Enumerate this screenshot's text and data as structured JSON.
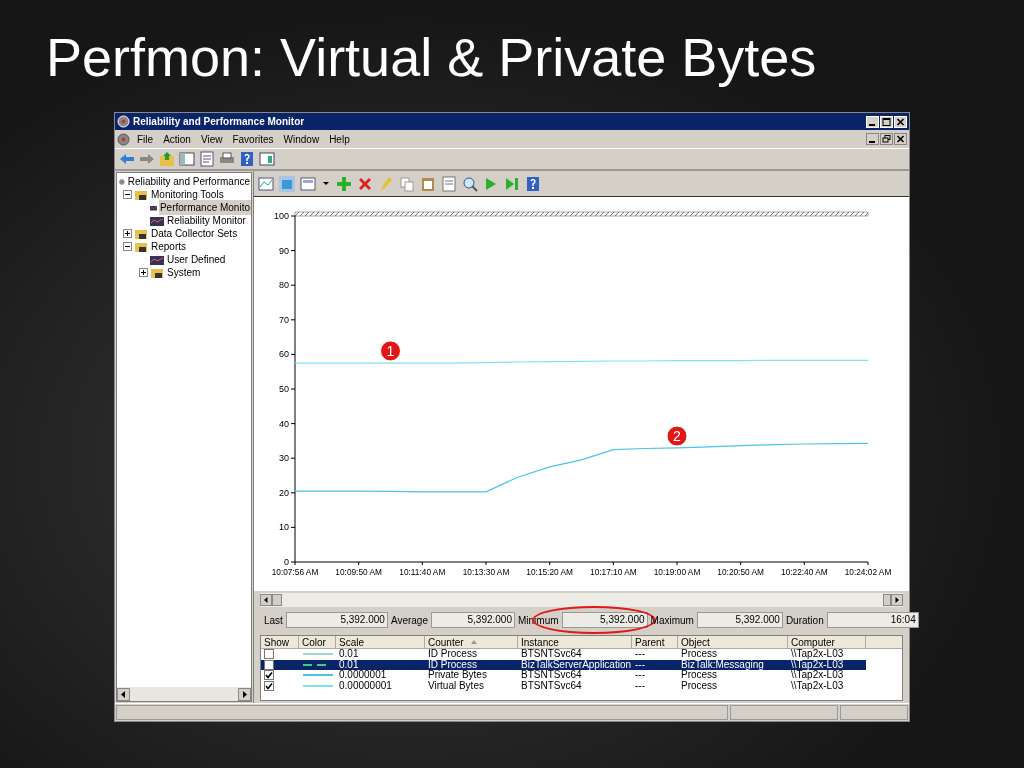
{
  "slide": {
    "title": "Perfmon: Virtual & Private Bytes"
  },
  "window": {
    "title": "Reliability and Performance Monitor"
  },
  "menu": [
    "File",
    "Action",
    "View",
    "Favorites",
    "Window",
    "Help"
  ],
  "tree": [
    {
      "label": "Reliability and Performance",
      "selected": false,
      "children": [
        {
          "label": "Monitoring Tools",
          "expanded": true,
          "selected": false,
          "children": [
            {
              "label": "Performance Monito",
              "selected": true
            },
            {
              "label": "Reliability Monitor",
              "selected": false
            }
          ]
        },
        {
          "label": "Data Collector Sets",
          "expanded": false,
          "selected": false
        },
        {
          "label": "Reports",
          "expanded": true,
          "selected": false,
          "children": [
            {
              "label": "User Defined",
              "selected": false
            },
            {
              "label": "System",
              "expanded": false,
              "selected": false
            }
          ]
        }
      ]
    }
  ],
  "chart_data": {
    "type": "line",
    "ylim": [
      0,
      100
    ],
    "yticks": [
      0,
      10,
      20,
      30,
      40,
      50,
      60,
      70,
      80,
      90,
      100
    ],
    "categories": [
      "10:07:56 AM",
      null,
      "10:09:50 AM",
      null,
      "10:11:40 AM",
      null,
      "10:13:30 AM",
      null,
      "10:15:20 AM",
      null,
      "10:17:10 AM",
      null,
      "10:19:00 AM",
      null,
      "10:20:50 AM",
      null,
      "10:22:40 AM",
      null,
      "10:24:02 AM"
    ],
    "series": [
      {
        "color": "#7fe3ef",
        "values": [
          57.5,
          57.5,
          57.5,
          57.5,
          57.5,
          57.5,
          57.6,
          57.8,
          57.9,
          58,
          58.1,
          58.1,
          58.2,
          58.2,
          58.2,
          58.3,
          58.3,
          58.3,
          58.3
        ]
      },
      {
        "color": "#4dc3e6",
        "values": [
          20.5,
          20.5,
          20.5,
          20.4,
          20.3,
          20.3,
          20.3,
          24.5,
          27.5,
          29.5,
          32.5,
          32.8,
          33,
          33.3,
          33.6,
          33.9,
          34.1,
          34.2,
          34.3
        ]
      }
    ],
    "annotations": [
      {
        "y": 61,
        "text": "1"
      },
      {
        "y": 36.4,
        "text": "2"
      }
    ]
  },
  "stats": [
    {
      "label": "Last",
      "value": "5,392.000",
      "highlighted": false
    },
    {
      "label": "Average",
      "value": "5,392.000",
      "highlighted": false
    },
    {
      "label": "Minimum",
      "value": "5,392.000",
      "highlighted": true
    },
    {
      "label": "Maximum",
      "value": "5,392.000",
      "highlighted": false
    },
    {
      "label": "Duration",
      "value": "16:04",
      "highlighted": false
    }
  ],
  "counters": {
    "columns": [
      {
        "label": "Show",
        "sorted": false
      },
      {
        "label": "Color",
        "sorted": false
      },
      {
        "label": "Scale",
        "sorted": false
      },
      {
        "label": "Counter",
        "sorted": true
      },
      {
        "label": "Instance",
        "sorted": false
      },
      {
        "label": "Parent",
        "sorted": false
      },
      {
        "label": "Object",
        "sorted": false
      },
      {
        "label": "Computer",
        "sorted": false
      }
    ],
    "rows": [
      {
        "show": false,
        "color": "#9fd8cf",
        "dashed": false,
        "scale": "0.01",
        "counter": "ID Process",
        "instance": "BTSNTSvc64",
        "parent": "---",
        "object": "Process",
        "computer": "\\\\Tap2x-L03",
        "selected": false
      },
      {
        "show": false,
        "color": "#3fd07a",
        "dashed": true,
        "scale": "0.01",
        "counter": "ID Process",
        "instance": "BizTalkServerApplication",
        "parent": "---",
        "object": "BizTalk:Messaging",
        "computer": "\\\\Tap2x-L03",
        "selected": true
      },
      {
        "show": true,
        "color": "#4dc3e6",
        "dashed": false,
        "scale": "0.0000001",
        "counter": "Private Bytes",
        "instance": "BTSNTSvc64",
        "parent": "---",
        "object": "Process",
        "computer": "\\\\Tap2x-L03",
        "selected": false
      },
      {
        "show": true,
        "color": "#7fe3ef",
        "dashed": false,
        "scale": "0.00000001",
        "counter": "Virtual Bytes",
        "instance": "BTSNTSvc64",
        "parent": "---",
        "object": "Process",
        "computer": "\\\\Tap2x-L03",
        "selected": false
      }
    ]
  }
}
